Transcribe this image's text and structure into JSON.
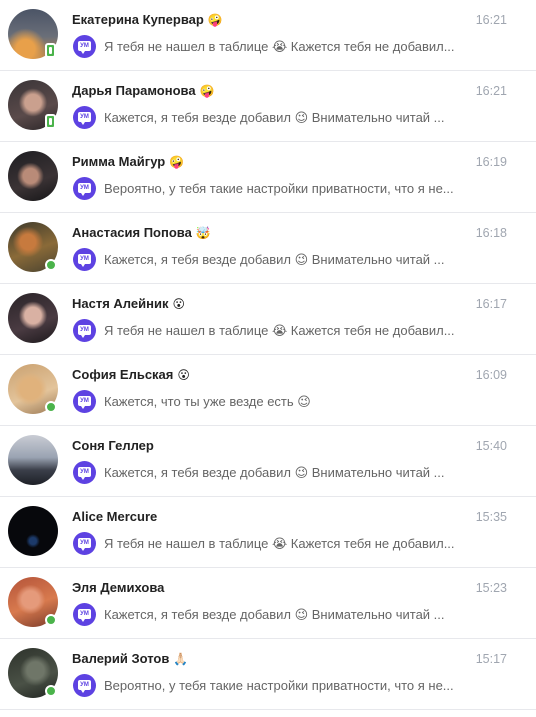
{
  "dialogs": [
    {
      "name": "Екатерина Купервар",
      "emoji": "🤪",
      "time": "16:21",
      "status": "mobile",
      "message": "Я тебя не нашел в таблице 😭 Кажется тебя не добавил...",
      "chat_badge": "УМ"
    },
    {
      "name": "Дарья Парамонова",
      "emoji": "🤪",
      "time": "16:21",
      "status": "mobile",
      "message": "Кажется, я тебя везде добавил 😉 Внимательно читай ...",
      "chat_badge": "УМ"
    },
    {
      "name": "Римма Майгур",
      "emoji": "🤪",
      "time": "16:19",
      "status": "none",
      "message": "Вероятно, у тебя такие настройки приватности, что я не...",
      "chat_badge": "УМ"
    },
    {
      "name": "Анастасия Попова",
      "emoji": "🤯",
      "time": "16:18",
      "status": "online",
      "message": "Кажется, я тебя везде добавил 😉 Внимательно читай ...",
      "chat_badge": "УМ"
    },
    {
      "name": "Настя Алейник",
      "emoji": "😮",
      "time": "16:17",
      "status": "none",
      "message": "Я тебя не нашел в таблице 😭 Кажется тебя не добавил...",
      "chat_badge": "УМ"
    },
    {
      "name": "София Ельская",
      "emoji": "😮",
      "time": "16:09",
      "status": "online",
      "message": "Кажется, что ты уже везде есть 😉",
      "chat_badge": "УМ"
    },
    {
      "name": "Соня Геллер",
      "emoji": "",
      "time": "15:40",
      "status": "none",
      "message": "Кажется, я тебя везде добавил 😉 Внимательно читай ...",
      "chat_badge": "УМ"
    },
    {
      "name": "Alice Mercure",
      "emoji": "",
      "time": "15:35",
      "status": "none",
      "message": "Я тебя не нашел в таблице 😭 Кажется тебя не добавил...",
      "chat_badge": "УМ"
    },
    {
      "name": "Эля Демихова",
      "emoji": "",
      "time": "15:23",
      "status": "online",
      "message": "Кажется, я тебя везде добавил 😉 Внимательно читай ...",
      "chat_badge": "УМ"
    },
    {
      "name": "Валерий Зотов",
      "emoji": "🙏🏻",
      "time": "15:17",
      "status": "online",
      "message": "Вероятно, у тебя такие настройки приватности, что я не...",
      "chat_badge": "УМ"
    }
  ],
  "colors": {
    "accent": "#5d42e2",
    "online": "#4bb34b",
    "name": "#222222",
    "message": "#656565",
    "time": "#a0a6b0",
    "divider": "#e7e8ec"
  }
}
